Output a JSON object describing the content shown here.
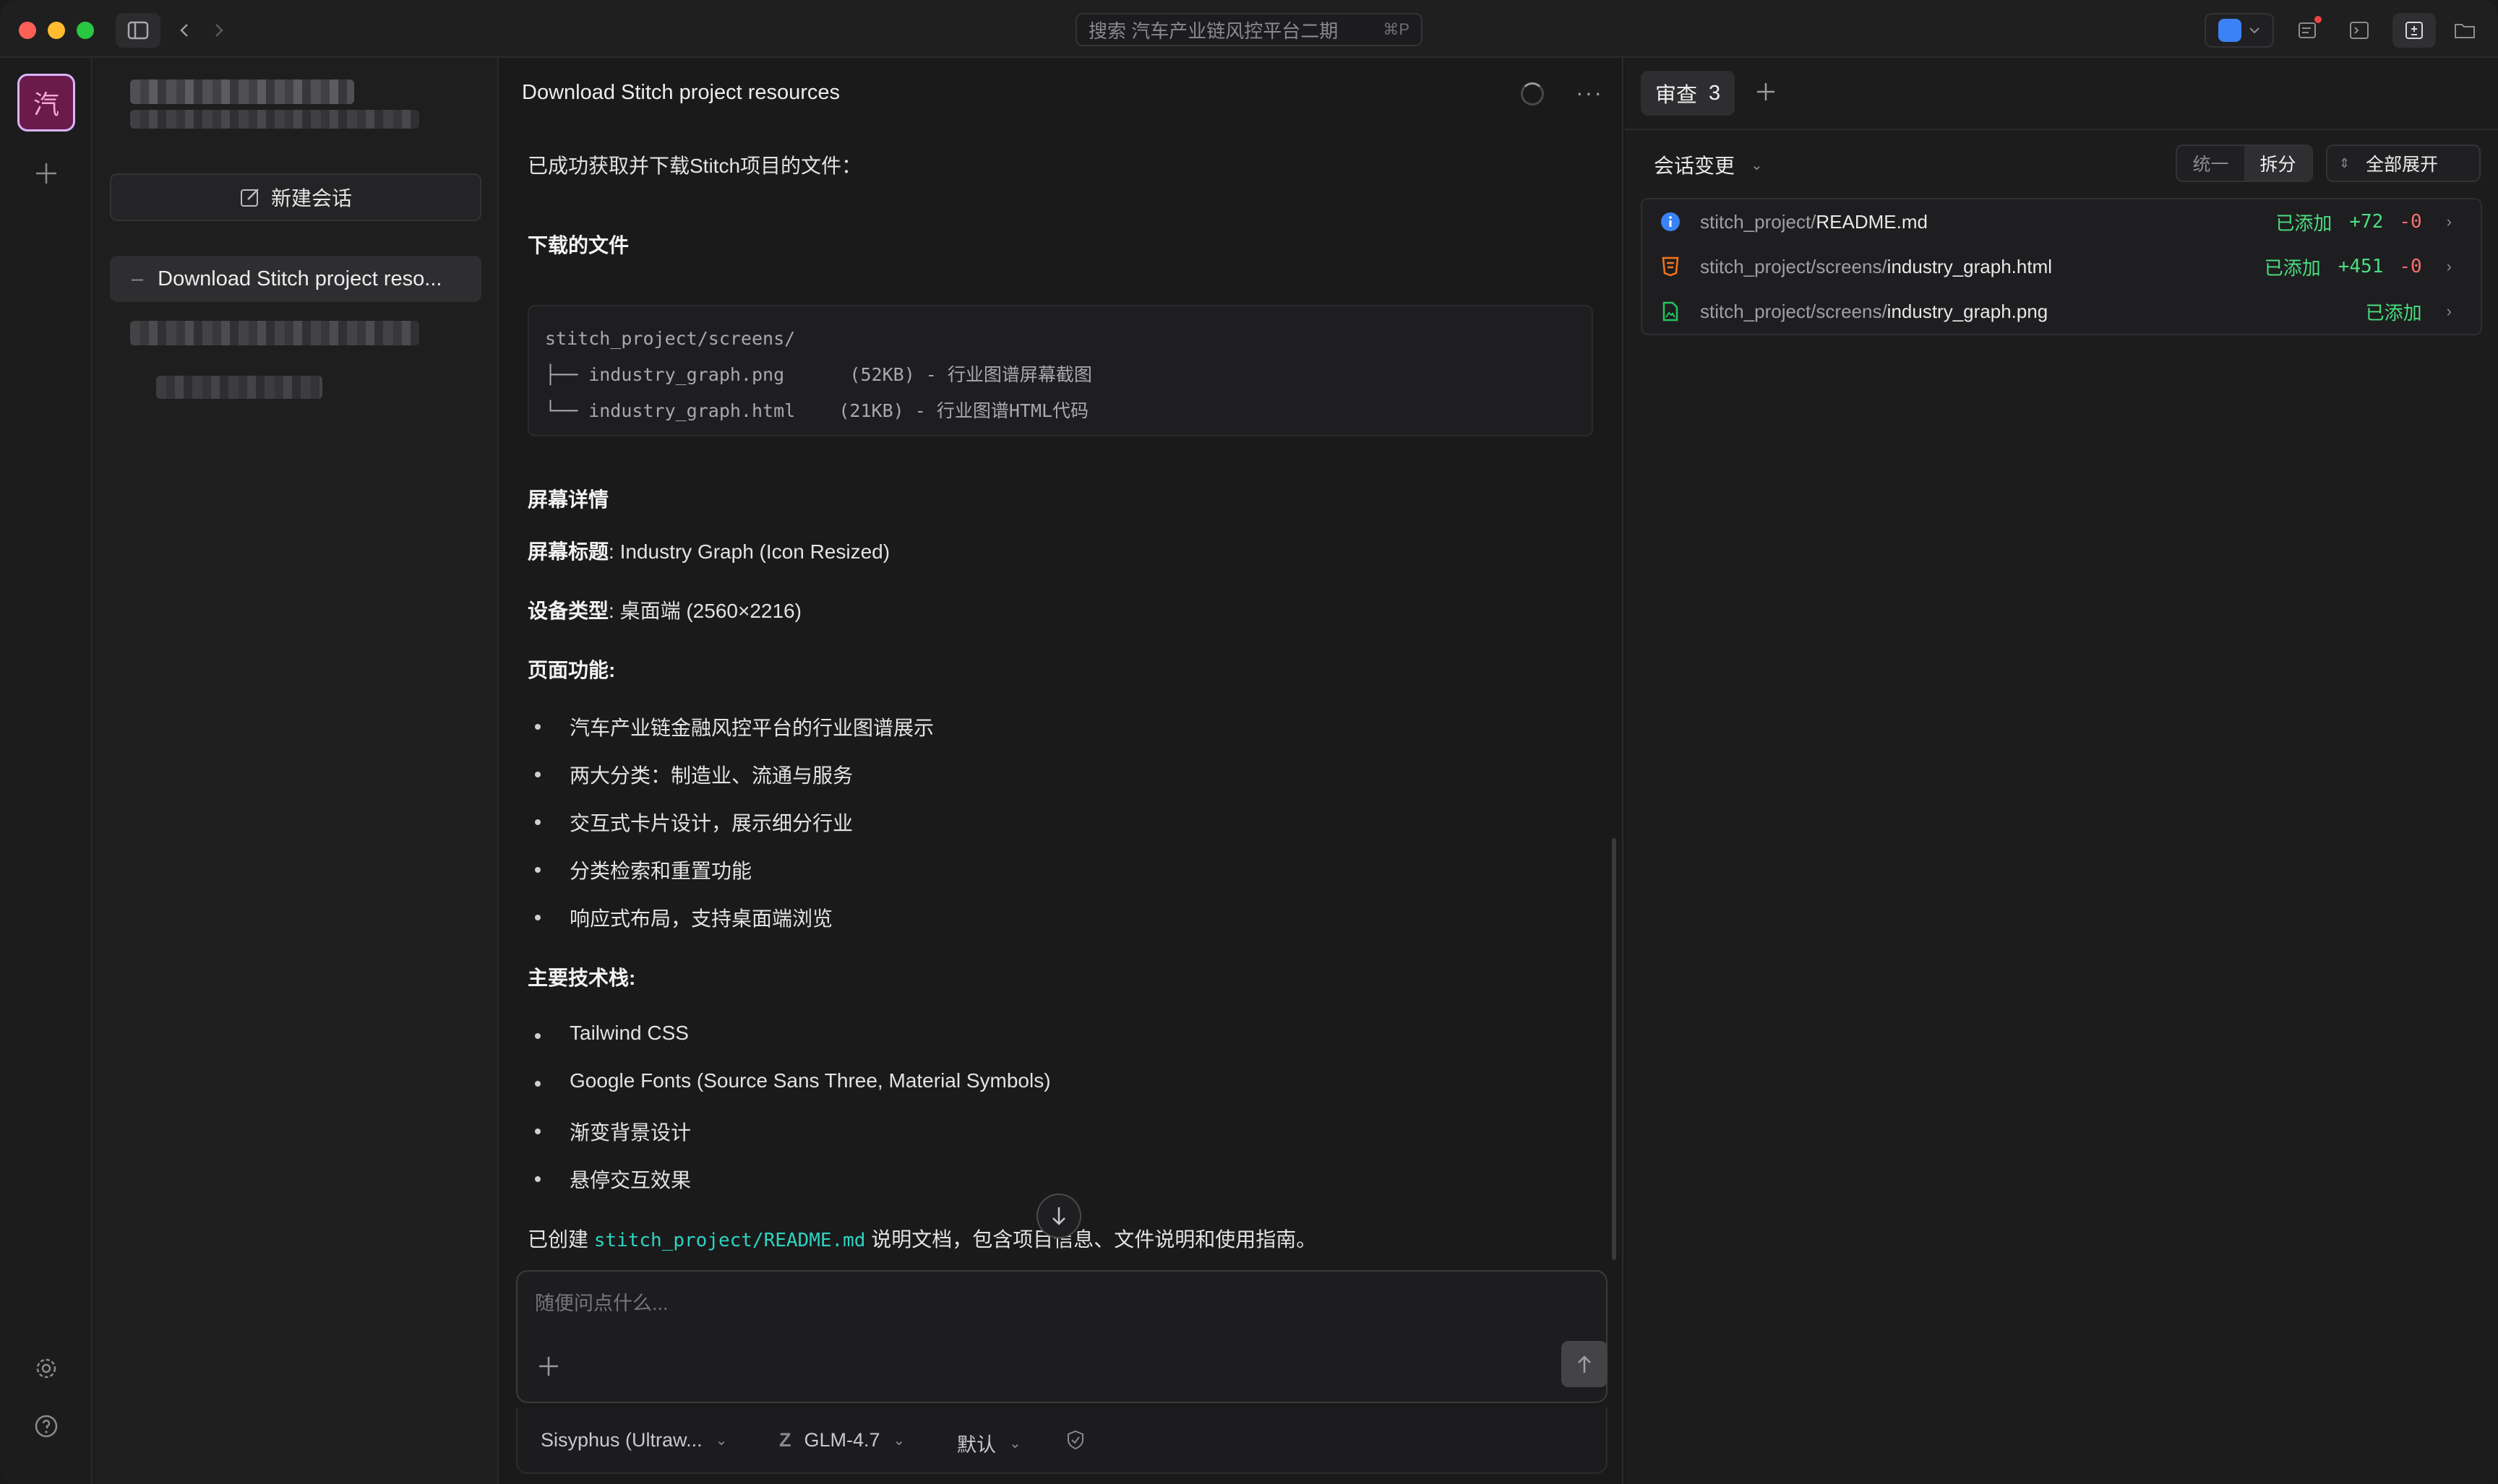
{
  "titlebar": {
    "search_placeholder": "搜索 汽车产业链风控平台二期",
    "search_shortcut": "⌘P"
  },
  "rail": {
    "workspace_initial": "汽"
  },
  "sessions": {
    "new_session_label": "新建会话",
    "active_session": "Download Stitch project reso..."
  },
  "chat": {
    "title": "Download Stitch project resources",
    "intro": "已成功获取并下载Stitch项目的文件：",
    "files_heading": "下载的文件",
    "code_lines": [
      "stitch_project/screens/",
      "├── industry_graph.png      (52KB) - 行业图谱屏幕截图",
      "└── industry_graph.html    (21KB) - 行业图谱HTML代码"
    ],
    "details_heading": "屏幕详情",
    "screen_title_label": "屏幕标题",
    "screen_title_value": ": Industry Graph (Icon Resized)",
    "device_label": "设备类型",
    "device_value": ": 桌面端 (2560×2216)",
    "features_label": "页面功能:",
    "features": [
      "汽车产业链金融风控平台的行业图谱展示",
      "两大分类：制造业、流通与服务",
      "交互式卡片设计，展示细分行业",
      "分类检索和重置功能",
      "响应式布局，支持桌面端浏览"
    ],
    "tech_label": "主要技术栈:",
    "tech": [
      "Tailwind CSS",
      "Google Fonts (Source Sans Three, Material Symbols)",
      "渐变背景设计",
      "悬停交互效果"
    ],
    "created_prefix": "已创建 ",
    "created_file": "stitch_project/README.md",
    "created_suffix": " 说明文档，包含项目信息、文件说明和使用指南。",
    "composer_placeholder": "随便问点什么...",
    "footer": {
      "agent": "Sisyphus (Ultraw...",
      "model": "GLM-4.7",
      "mode": "默认"
    }
  },
  "review": {
    "tab_label": "审查",
    "tab_count": "3",
    "changes_title": "会话变更",
    "seg_unified": "统一",
    "seg_split": "拆分",
    "expand_all": "全部展开",
    "files": [
      {
        "dir": "stitch_project/",
        "name": "README.md",
        "status": "已添加",
        "plus": "+72",
        "minus": "-0",
        "icon": "info-icon",
        "color": "#3b82f6"
      },
      {
        "dir": "stitch_project/screens/",
        "name": "industry_graph.html",
        "status": "已添加",
        "plus": "+451",
        "minus": "-0",
        "icon": "html-icon",
        "color": "#f97316"
      },
      {
        "dir": "stitch_project/screens/",
        "name": "industry_graph.png",
        "status": "已添加",
        "plus": "",
        "minus": "",
        "icon": "image-file-icon",
        "color": "#22c55e"
      }
    ]
  }
}
